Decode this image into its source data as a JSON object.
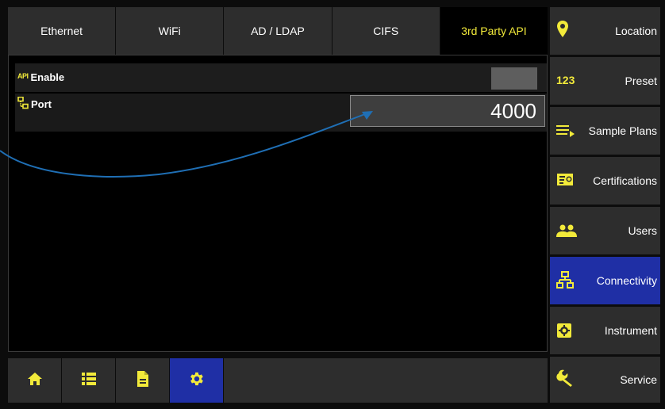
{
  "tabs": [
    {
      "label": "Ethernet",
      "active": false
    },
    {
      "label": "WiFi",
      "active": false
    },
    {
      "label": "AD / LDAP",
      "active": false
    },
    {
      "label": "CIFS",
      "active": false
    },
    {
      "label": "3rd Party API",
      "active": true
    }
  ],
  "settings": {
    "enable": {
      "icon_text": "API",
      "label": "Enable",
      "value": "off"
    },
    "port": {
      "label": "Port",
      "value": "4000"
    }
  },
  "sidebar": {
    "items": [
      {
        "label": "Location",
        "icon": "location-pin-icon",
        "active": false
      },
      {
        "label": "Preset",
        "icon": "number-123-icon",
        "icon_text": "123",
        "active": false
      },
      {
        "label": "Sample Plans",
        "icon": "list-arrow-icon",
        "active": false
      },
      {
        "label": "Certifications",
        "icon": "certificate-icon",
        "active": false
      },
      {
        "label": "Users",
        "icon": "users-icon",
        "active": false
      },
      {
        "label": "Connectivity",
        "icon": "network-icon",
        "active": true
      },
      {
        "label": "Instrument",
        "icon": "instrument-icon",
        "active": false
      },
      {
        "label": "Service",
        "icon": "wrench-icon",
        "active": false
      }
    ]
  },
  "toolbar": {
    "buttons": [
      {
        "icon": "home-icon",
        "active": false
      },
      {
        "icon": "list-icon",
        "active": false
      },
      {
        "icon": "document-icon",
        "active": false
      },
      {
        "icon": "gear-icon",
        "active": true
      }
    ]
  },
  "colors": {
    "accent_yellow": "#f2ea3a",
    "active_blue": "#1f2fa5",
    "panel_gray": "#2d2d2d",
    "annotation_arrow": "#1f6fb5"
  }
}
